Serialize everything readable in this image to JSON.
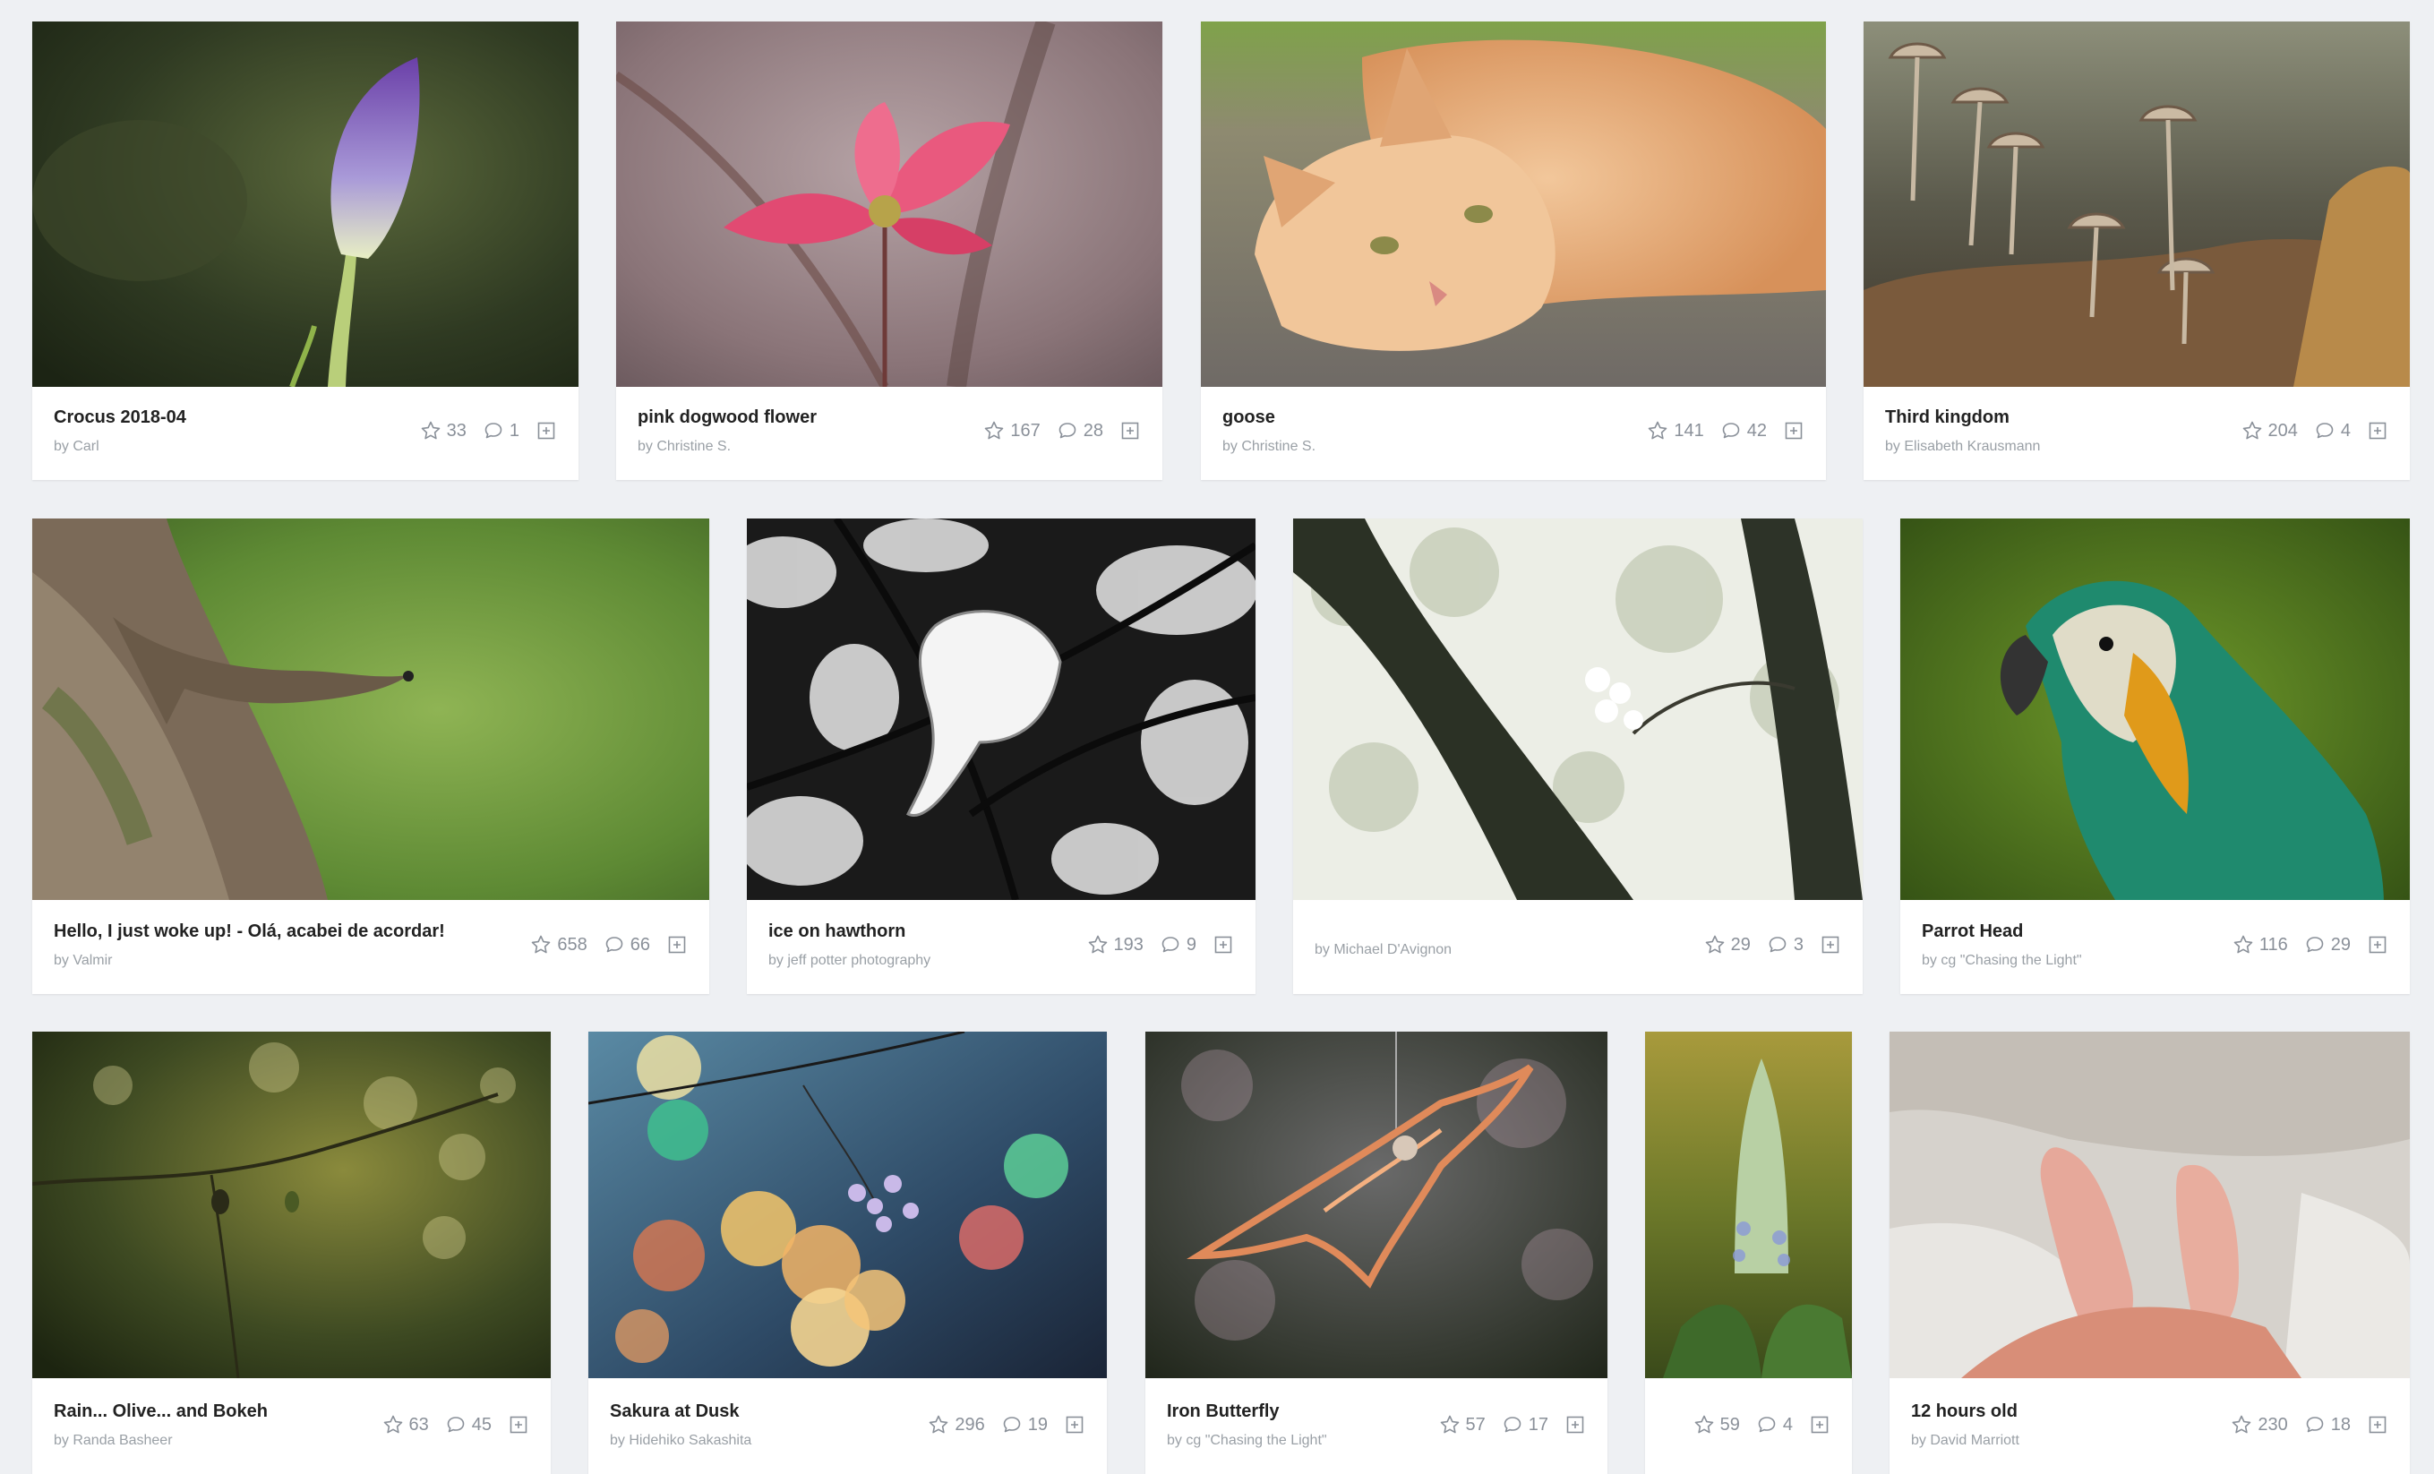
{
  "photos": [
    {
      "title": "Crocus 2018-04",
      "author": "by Carl",
      "likes": "33",
      "comments": "1"
    },
    {
      "title": "pink dogwood flower",
      "author": "by Christine S.",
      "likes": "167",
      "comments": "28"
    },
    {
      "title": "goose",
      "author": "by Christine S.",
      "likes": "141",
      "comments": "42"
    },
    {
      "title": "Third kingdom",
      "author": "by Elisabeth Krausmann",
      "likes": "204",
      "comments": "4"
    },
    {
      "title": "Hello, I just woke up! - Olá, acabei de acordar!",
      "author": "by Valmir",
      "likes": "658",
      "comments": "66"
    },
    {
      "title": "ice on hawthorn",
      "author": "by jeff potter photography",
      "likes": "193",
      "comments": "9"
    },
    {
      "title": "",
      "author": "by Michael D'Avignon",
      "likes": "29",
      "comments": "3"
    },
    {
      "title": "Parrot Head",
      "author": "by cg \"Chasing the Light\"",
      "likes": "116",
      "comments": "29"
    },
    {
      "title": "Rain... Olive... and Bokeh",
      "author": "by Randa Basheer",
      "likes": "63",
      "comments": "45"
    },
    {
      "title": "Sakura at Dusk",
      "author": "by Hidehiko Sakashita",
      "likes": "296",
      "comments": "19"
    },
    {
      "title": "Iron Butterfly",
      "author": "by cg \"Chasing the Light\"",
      "likes": "57",
      "comments": "17"
    },
    {
      "title": "",
      "author": "",
      "likes": "59",
      "comments": "4"
    },
    {
      "title": "12 hours old",
      "author": "by David Marriott",
      "likes": "230",
      "comments": "18"
    }
  ],
  "icons": {
    "like": "star-outline-icon",
    "comment": "speech-bubble-icon",
    "add": "plus-square-icon"
  },
  "colors": {
    "page_bg": "#eef0f3",
    "card_bg": "#ffffff",
    "title": "#222222",
    "meta": "#9aa0a6"
  }
}
